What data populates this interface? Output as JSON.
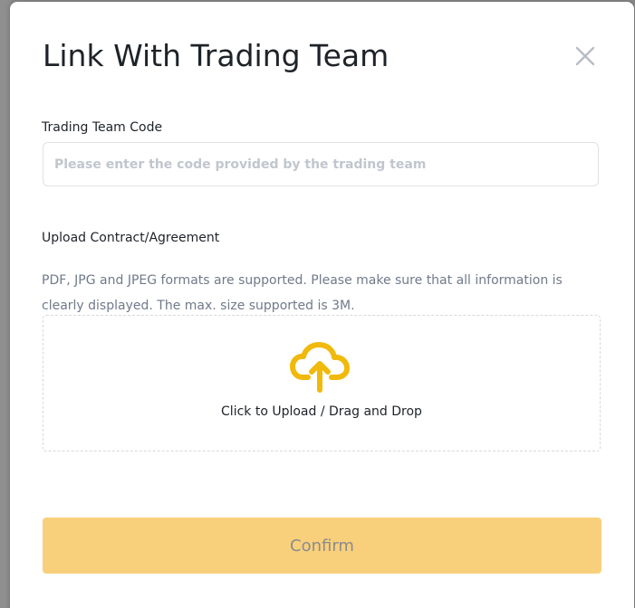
{
  "modal": {
    "title": "Link With Trading Team",
    "close_icon": "close-icon"
  },
  "team_code": {
    "label": "Trading Team Code",
    "value": "",
    "placeholder": "Please enter the code provided by the trading team"
  },
  "upload": {
    "label": "Upload Contract/Agreement",
    "hint": "PDF, JPG and JPEG formats are supported. Please make sure that all information is clearly displayed. The max. size supported is 3M.",
    "drop_text": "Click to Upload / Drag and Drop",
    "icon": "cloud-upload-icon"
  },
  "actions": {
    "confirm_label": "Confirm"
  },
  "colors": {
    "accent": "#f0b90b",
    "confirm_bg_disabled": "#f8d07c",
    "text_primary": "#1e2329",
    "text_secondary": "#707a8a",
    "placeholder": "#c1c6ce"
  }
}
